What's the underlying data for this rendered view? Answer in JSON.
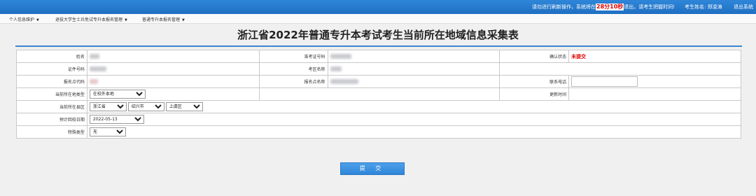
{
  "topbar": {
    "notice_before": "请勿进行刷新操作，系统将在",
    "countdown": "28分10秒",
    "notice_after": "退出，请考生把握时间!",
    "student_label": "考生姓名: 郑浚涛",
    "logout": "退出系统"
  },
  "menu": [
    {
      "label": "个人信息维护"
    },
    {
      "label": "退役大学生士兵免试专升本报名管理"
    },
    {
      "label": "普通专升本报名管理"
    }
  ],
  "title": "浙江省2022年普通专升本考试考生当前所在地域信息采集表",
  "form": {
    "name_label": "姓名",
    "exam_no_label": "准考证号码",
    "confirm_label": "确认状态",
    "confirm_value": "未提交",
    "id_label": "证件号码",
    "exam_area_label": "考区名称",
    "site_code_label": "报名点代码",
    "site_name_label": "报名点名称",
    "phone_label": "联系电话",
    "location_type_label": "当前所在地类型",
    "location_type_value": "在校外本地",
    "update_time_label": "更新时间",
    "region_label": "当前所在县区",
    "province_value": "浙江省",
    "city_value": "绍兴市",
    "district_value": "上虞区",
    "return_date_label": "预计回校日期",
    "return_date_value": "2022-05-13",
    "special_label": "特殊类型",
    "special_value": "无"
  },
  "submit_label": "提 交"
}
